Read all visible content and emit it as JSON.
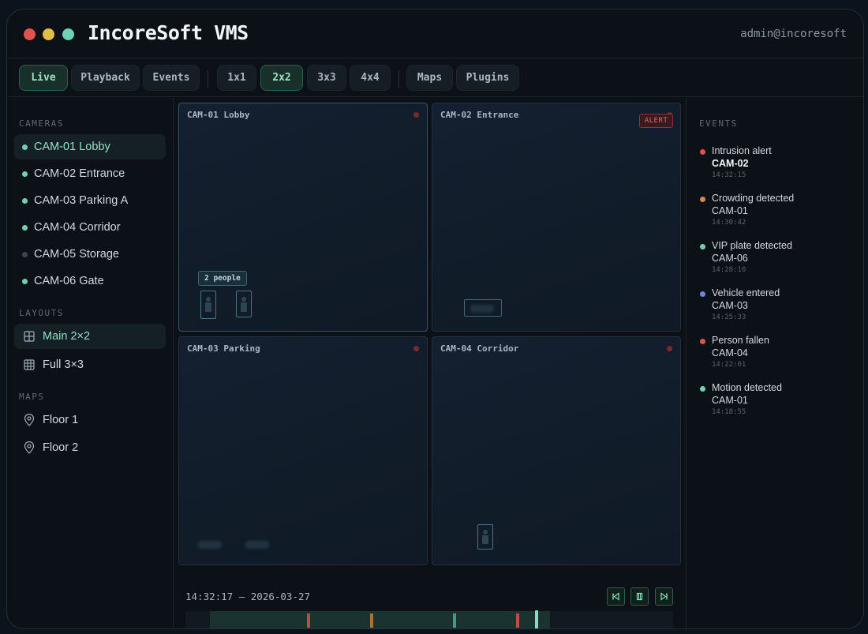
{
  "window": {
    "title": "IncoreSoft VMS",
    "user": "admin@incoresoft",
    "traffic_lights": [
      "#e0524d",
      "#e0bf45",
      "#6fd1b3"
    ]
  },
  "toolbar": {
    "modes": [
      {
        "label": "Live",
        "active": true
      },
      {
        "label": "Playback",
        "active": false
      },
      {
        "label": "Events",
        "active": false
      }
    ],
    "grids": [
      {
        "label": "1x1",
        "active": false
      },
      {
        "label": "2x2",
        "active": true
      },
      {
        "label": "3x3",
        "active": false
      },
      {
        "label": "4x4",
        "active": false
      }
    ],
    "extras": [
      {
        "label": "Maps"
      },
      {
        "label": "Plugins"
      }
    ]
  },
  "sidebar": {
    "cameras_heading": "CAMERAS",
    "cameras": [
      {
        "label": "CAM-01 Lobby",
        "status": "online",
        "active": true
      },
      {
        "label": "CAM-02 Entrance",
        "status": "online",
        "active": false
      },
      {
        "label": "CAM-03 Parking A",
        "status": "online",
        "active": false
      },
      {
        "label": "CAM-04 Corridor",
        "status": "online",
        "active": false
      },
      {
        "label": "CAM-05 Storage",
        "status": "offline",
        "active": false
      },
      {
        "label": "CAM-06 Gate",
        "status": "online",
        "active": false
      }
    ],
    "layouts_heading": "LAYOUTS",
    "layouts": [
      {
        "label": "Main 2×2",
        "icon": "grid-icon",
        "active": true
      },
      {
        "label": "Full 3×3",
        "icon": "grid-icon",
        "active": false
      }
    ],
    "maps_heading": "MAPS",
    "maps": [
      {
        "label": "Floor 1",
        "icon": "map-pin-icon"
      },
      {
        "label": "Floor 2",
        "icon": "map-pin-icon"
      }
    ]
  },
  "grid": {
    "tiles": [
      {
        "label": "CAM-01 Lobby",
        "detection_tag": "2 people"
      },
      {
        "label": "CAM-02 Entrance",
        "alert": "ALERT"
      },
      {
        "label": "CAM-03 Parking"
      },
      {
        "label": "CAM-04 Corridor"
      }
    ]
  },
  "playback": {
    "timestamp": "14:32:17 — 2026-03-27",
    "controls": [
      "skip-back-icon",
      "pause-icon",
      "skip-forward-icon"
    ],
    "event_mark_colors": [
      "#b8503f",
      "#a07638",
      "#3f9c84",
      "#b8503f"
    ]
  },
  "events": {
    "heading": "EVENTS",
    "items": [
      {
        "title": "Intrusion alert",
        "camera": "CAM-02",
        "time": "14:32:15",
        "color": "#e0524d",
        "emphasis": true
      },
      {
        "title": "Crowding detected",
        "camera": "CAM-01",
        "time": "14:30:42",
        "color": "#e08a45",
        "emphasis": false
      },
      {
        "title": "VIP plate detected",
        "camera": "CAM-06",
        "time": "14:28:10",
        "color": "#6fd1b3",
        "emphasis": false
      },
      {
        "title": "Vehicle entered",
        "camera": "CAM-03",
        "time": "14:25:33",
        "color": "#6b86e0",
        "emphasis": false
      },
      {
        "title": "Person fallen",
        "camera": "CAM-04",
        "time": "14:22:01",
        "color": "#e0524d",
        "emphasis": false
      },
      {
        "title": "Motion detected",
        "camera": "CAM-01",
        "time": "14:18:55",
        "color": "#6fd1b3",
        "emphasis": false
      }
    ]
  }
}
